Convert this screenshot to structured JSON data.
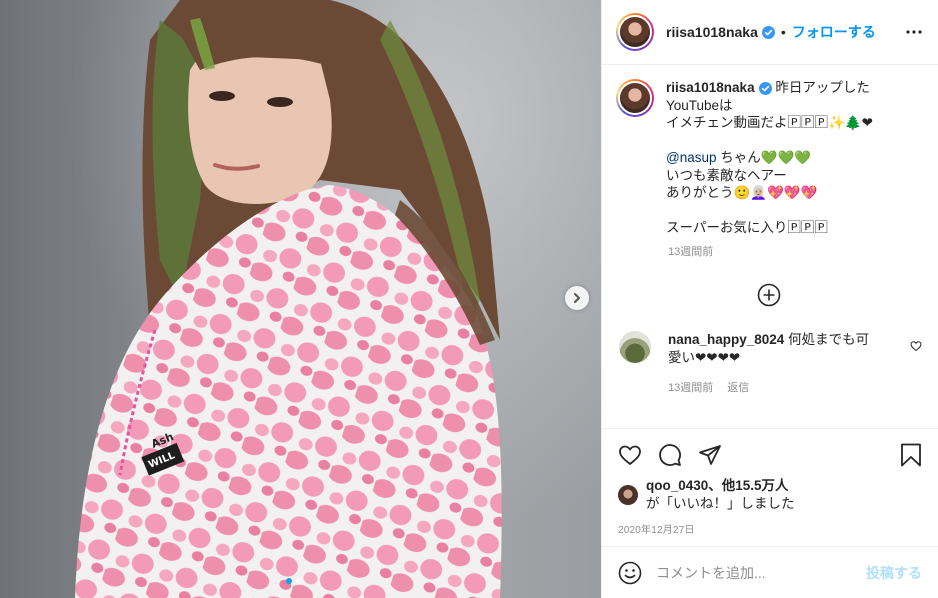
{
  "post": {
    "author": "riisa1018naka",
    "follow_label": "フォローする",
    "separator": "•",
    "caption_lines": [
      "昨日アップした",
      "YouTubeは",
      "イメチェン動画だよ🄿🄿🄿✨🌲❤",
      "",
      "ちゃん💚💚💚",
      "いつも素敵なヘアー",
      "ありがとう🙂👩🏼‍🦳💖💖💖",
      "",
      "スーパーお気に入り🄿🄿🄿"
    ],
    "mention": "@nasup",
    "caption_time": "13週間前",
    "photo": {
      "image_text": [
        "Ash",
        "WILL"
      ],
      "current_slide": 1,
      "slide_count": 2
    }
  },
  "comment": {
    "user": "nana_happy_8024",
    "text": "何処までも可愛い❤❤❤❤",
    "time": "13週間前",
    "reply_label": "返信"
  },
  "likes": {
    "first_user": "qoo_0430",
    "others": "、他15.5万人",
    "suffix": "が「いいね！」しました"
  },
  "date": "2020年12月27日",
  "composer": {
    "placeholder": "コメントを追加...",
    "post_label": "投稿する"
  },
  "colors": {
    "accent": "#0095f6",
    "post_disabled": "#b2dffc",
    "muted": "#8e8e8e"
  }
}
